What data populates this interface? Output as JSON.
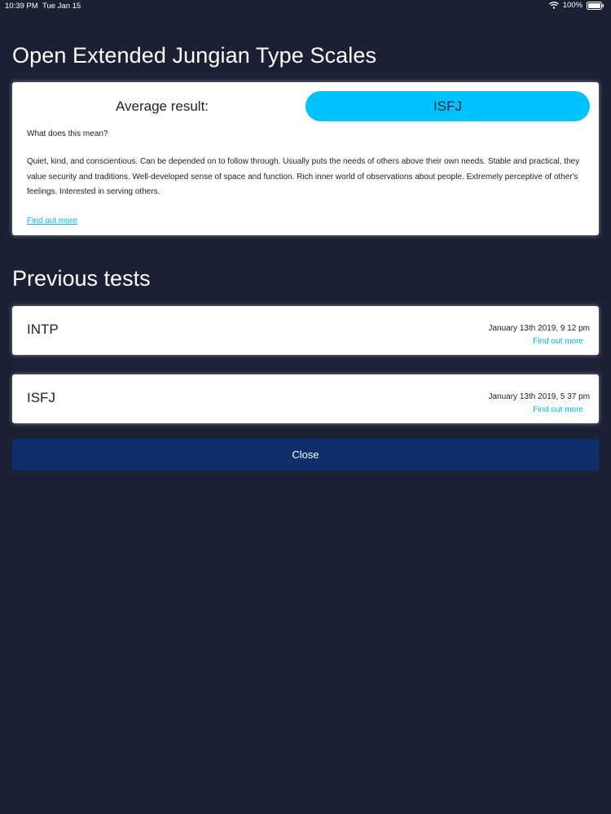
{
  "status_bar": {
    "time": "10:39 PM",
    "date": "Tue Jan 15",
    "battery": "100%",
    "icons": [
      "wifi-icon",
      "battery-icon"
    ]
  },
  "title": "Open Extended Jungian Type Scales",
  "result": {
    "label": "Average result:",
    "type": "ISFJ",
    "question": "What does this mean?",
    "description": "Quiet, kind, and conscientious. Can be depended on to follow through. Usually puts the needs of others above their own needs. Stable and practical, they value security and traditions. Well-developed sense of space and function. Rich inner world of observations about people. Extremely perceptive of other's feelings. Interested in serving others.",
    "link": "Find out more"
  },
  "previous": {
    "title": "Previous tests",
    "tests": [
      {
        "type": "INTP",
        "date": "January 13th 2019, 9 12 pm",
        "link": "Find out more"
      },
      {
        "type": "ISFJ",
        "date": "January 13th 2019, 5 37 pm",
        "link": "Find out more"
      }
    ]
  },
  "close_label": "Close",
  "colors": {
    "background": "#1b2035",
    "accent": "#00c2ff",
    "link": "#00b4ee",
    "close_button": "#0e2f6b"
  }
}
